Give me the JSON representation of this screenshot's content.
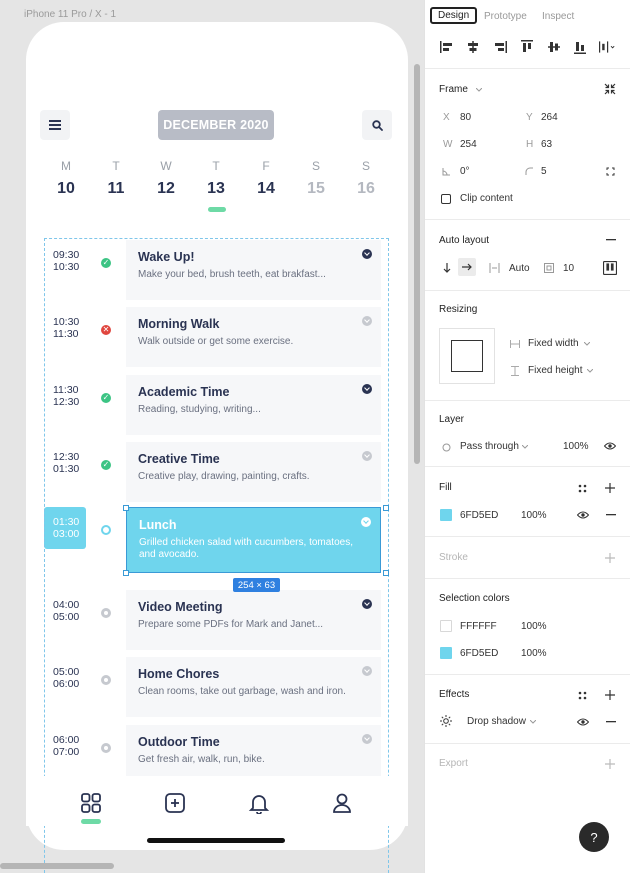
{
  "canvas": {
    "frame_label": "iPhone 11 Pro / X - 1"
  },
  "app": {
    "month": "DECEMBER 2020",
    "week": [
      {
        "label": "M",
        "num": "10",
        "muted": false
      },
      {
        "label": "T",
        "num": "11",
        "muted": false
      },
      {
        "label": "W",
        "num": "12",
        "muted": false
      },
      {
        "label": "T",
        "num": "13",
        "muted": false
      },
      {
        "label": "F",
        "num": "14",
        "muted": false
      },
      {
        "label": "S",
        "num": "15",
        "muted": true
      },
      {
        "label": "S",
        "num": "16",
        "muted": true
      }
    ],
    "tasks": [
      {
        "start": "09:30",
        "end": "10:30",
        "status": "done",
        "title": "Wake Up!",
        "desc": "Make your bed, brush teeth, eat brakfast...",
        "dark": true
      },
      {
        "start": "10:30",
        "end": "11:30",
        "status": "fail",
        "title": "Morning Walk",
        "desc": "Walk outside or get some exercise.",
        "dark": false
      },
      {
        "start": "11:30",
        "end": "12:30",
        "status": "done",
        "title": "Academic Time",
        "desc": "Reading, studying, writing...",
        "dark": true
      },
      {
        "start": "12:30",
        "end": "01:30",
        "status": "done",
        "title": "Creative Time",
        "desc": "Creative play, drawing, painting, crafts.",
        "dark": false
      },
      {
        "start": "01:30",
        "end": "03:00",
        "status": "active",
        "title": "Lunch",
        "desc": "Grilled chicken salad with cucumbers, tomatoes, and avocado.",
        "dark": false
      },
      {
        "start": "04:00",
        "end": "05:00",
        "status": "pending",
        "title": "Video Meeting",
        "desc": "Prepare some PDFs for Mark and Janet...",
        "dark": true
      },
      {
        "start": "05:00",
        "end": "06:00",
        "status": "pending",
        "title": "Home Chores",
        "desc": "Clean rooms, take out garbage, wash and iron.",
        "dark": false
      },
      {
        "start": "06:00",
        "end": "07:00",
        "status": "pending",
        "title": "Outdoor Time",
        "desc": "Get fresh air, walk, run, bike.",
        "dark": false
      }
    ],
    "selection_size": "254 × 63",
    "tabs": [
      "grid-icon",
      "plus-square-icon",
      "bell-icon",
      "user-icon"
    ]
  },
  "panel": {
    "tabs": [
      "Design",
      "Prototype",
      "Inspect"
    ],
    "frame": {
      "title": "Frame",
      "x_label": "X",
      "x": "80",
      "y_label": "Y",
      "y": "264",
      "w_label": "W",
      "w": "254",
      "h_label": "H",
      "h": "63",
      "rotation": "0°",
      "radius": "5",
      "clip": "Clip content"
    },
    "auto_layout": {
      "title": "Auto layout",
      "spacing_mode": "Auto",
      "padding": "10"
    },
    "resizing": {
      "title": "Resizing",
      "width": "Fixed width",
      "height": "Fixed height"
    },
    "layer": {
      "title": "Layer",
      "blend": "Pass through",
      "opacity": "100%"
    },
    "fill": {
      "title": "Fill",
      "hex": "6FD5ED",
      "opacity": "100%",
      "color": "#6fd5ed"
    },
    "stroke": {
      "title": "Stroke"
    },
    "selection_colors": {
      "title": "Selection colors",
      "items": [
        {
          "hex": "FFFFFF",
          "opacity": "100%",
          "color": "#ffffff"
        },
        {
          "hex": "6FD5ED",
          "opacity": "100%",
          "color": "#6fd5ed"
        }
      ]
    },
    "effects": {
      "title": "Effects",
      "shadow": "Drop shadow"
    },
    "export": {
      "title": "Export"
    },
    "help": "?"
  },
  "colors": {
    "accent": "#6fd5ed",
    "navy": "#2a3352",
    "done": "#3cc484",
    "fail": "#e0463f",
    "indicator": "#6edaa6"
  }
}
